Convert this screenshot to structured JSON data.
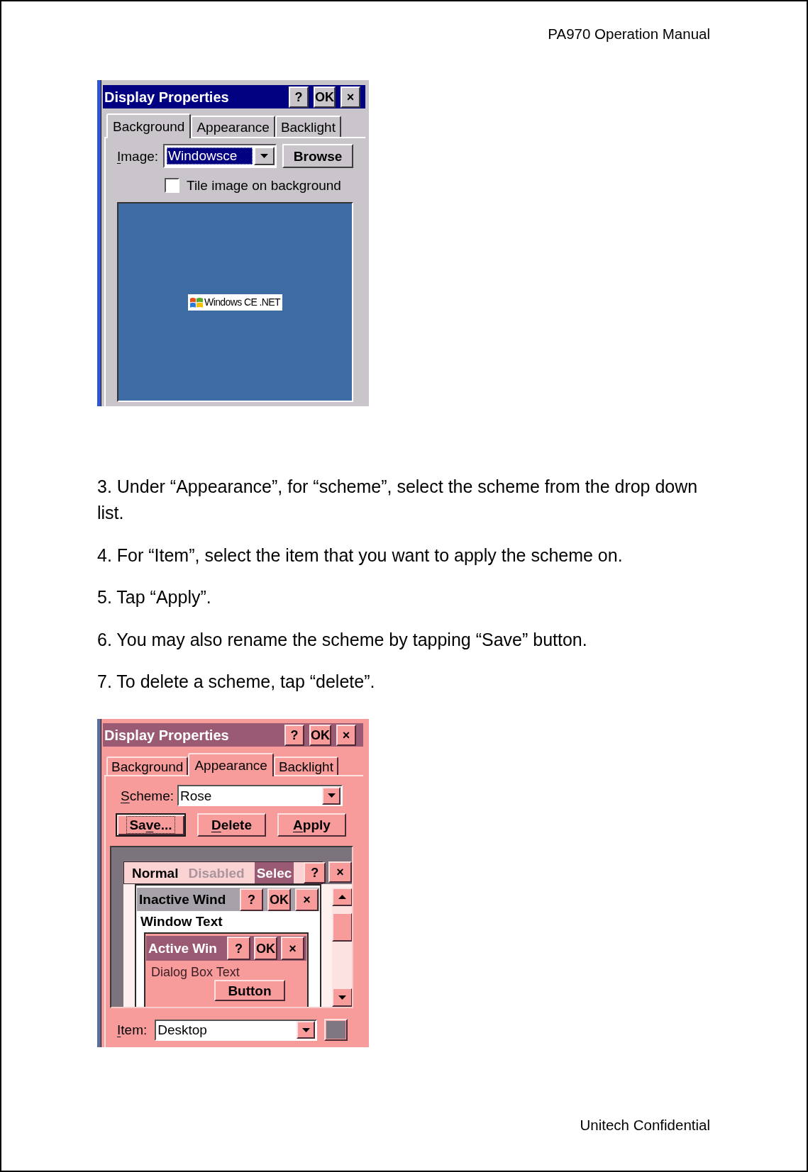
{
  "header": {
    "title": "PA970 Operation Manual"
  },
  "figure_1": {
    "title": "Display Properties",
    "title_buttons": [
      "?",
      "OK",
      "×"
    ],
    "tabs": [
      {
        "label": "Background",
        "selected": true
      },
      {
        "label": "Appearance",
        "selected": false
      },
      {
        "label": "Backlight",
        "selected": false
      }
    ],
    "image_field": {
      "label": [
        {
          "text": "I",
          "underlined": true
        },
        {
          "text": "mage:",
          "underlined": false
        }
      ],
      "value": "Windowsce",
      "focused": true
    },
    "browse_button": "Browse",
    "tile_checkbox": {
      "label": "Tile image on background",
      "checked": false
    },
    "preview": {
      "logo_text": "Windows CE .NET"
    }
  },
  "steps": [
    "3. Under “Appearance”, for “scheme”, select the scheme from the drop down list.",
    "4. For “Item”, select the item that you want to apply the scheme on.",
    "5. Tap “Apply”.",
    "6. You may also rename the scheme by tapping “Save” button.",
    "7. To delete a scheme, tap “delete”."
  ],
  "figure_2": {
    "title": "Display Properties",
    "title_buttons": [
      "?",
      "OK",
      "×"
    ],
    "tabs": [
      {
        "label": "Background",
        "selected": false
      },
      {
        "label": "Appearance",
        "selected": true
      },
      {
        "label": "Backlight",
        "selected": false
      }
    ],
    "scheme_field": {
      "label": [
        {
          "text": "S",
          "underlined": true
        },
        {
          "text": "cheme:",
          "underlined": false
        }
      ],
      "value": "Rose"
    },
    "action_buttons": [
      {
        "label": [
          {
            "text": "Sa",
            "underlined": false
          },
          {
            "text": "v",
            "underlined": true
          },
          {
            "text": "e...",
            "underlined": false
          }
        ],
        "focused": true
      },
      {
        "label": [
          {
            "text": "D",
            "underlined": true
          },
          {
            "text": "elete",
            "underlined": false
          }
        ],
        "focused": false
      },
      {
        "label": [
          {
            "text": "A",
            "underlined": true
          },
          {
            "text": "pply",
            "underlined": false
          }
        ],
        "focused": false
      }
    ],
    "preview": {
      "menu_items": [
        {
          "label": "Normal",
          "selected": false,
          "disabled": false
        },
        {
          "label": "Disabled",
          "selected": false,
          "disabled": true
        },
        {
          "label": "Selec",
          "selected": true,
          "disabled": false
        }
      ],
      "menu_buttons": [
        "?",
        "×"
      ],
      "inactive_window": {
        "title": "Inactive Wind",
        "buttons": [
          "?",
          "OK",
          "×"
        ],
        "text": "Window Text"
      },
      "active_window": {
        "title": "Active Win",
        "buttons": [
          "?",
          "OK",
          "×"
        ],
        "text": "Dialog Box Text",
        "button": "Button"
      }
    },
    "item_field": {
      "label": [
        {
          "text": "I",
          "underlined": true
        },
        {
          "text": "tem:",
          "underlined": false
        }
      ],
      "value": "Desktop"
    }
  },
  "footer": {
    "text": "Unitech Confidential"
  }
}
